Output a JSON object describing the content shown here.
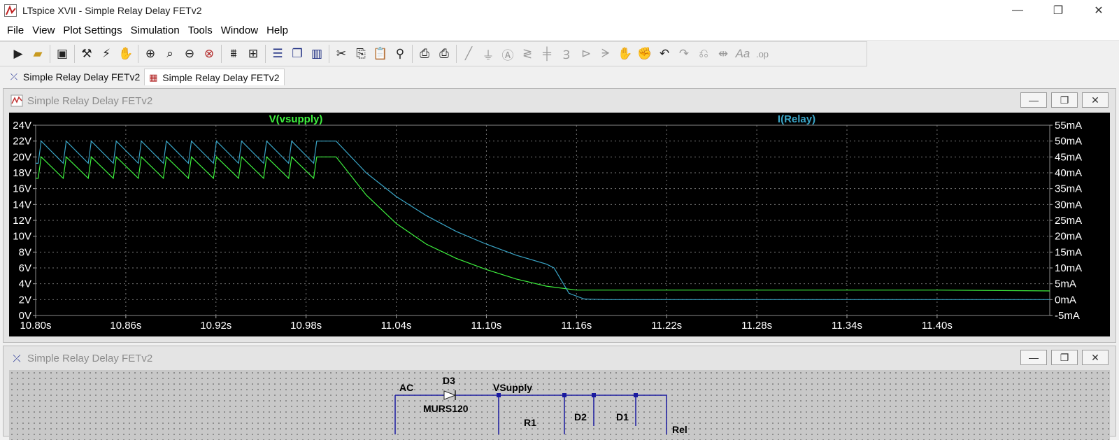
{
  "window": {
    "title": "LTspice XVII - Simple Relay Delay FETv2",
    "controls": [
      "—",
      "❐",
      "✕"
    ]
  },
  "menu": [
    {
      "label": "File"
    },
    {
      "label": "View"
    },
    {
      "label": "Plot Settings"
    },
    {
      "label": "Simulation"
    },
    {
      "label": "Tools"
    },
    {
      "label": "Window"
    },
    {
      "label": "Help"
    }
  ],
  "toolbar": {
    "icons": [
      "run-icon",
      "open-icon",
      "save-icon",
      "control-panel-icon",
      "run-man-icon",
      "pan-hand-icon",
      "zoom-in-icon",
      "zoom-area-icon",
      "zoom-out-icon",
      "zoom-cancel-icon",
      "autorange-icon",
      "add-plot-icon",
      "tile-horizontal-icon",
      "cascade-icon",
      "tile-vertical-icon",
      "cut-icon",
      "copy-icon",
      "paste-icon",
      "find-icon",
      "print-icon",
      "print-setup-icon",
      "wire-icon",
      "ground-icon",
      "label-icon",
      "resistor-icon",
      "capacitor-icon",
      "inductor-icon",
      "diode-icon",
      "component-icon",
      "move-icon",
      "drag-icon",
      "undo-icon",
      "redo-icon",
      "rotate-icon",
      "mirror-icon",
      "text-icon",
      "spice-directive-icon"
    ]
  },
  "tabs": [
    {
      "label": "Simple Relay Delay FETv2",
      "kind": "schematic"
    },
    {
      "label": "Simple Relay Delay FETv2",
      "kind": "waveform"
    }
  ],
  "plot_window": {
    "title": "Simple Relay Delay FETv2"
  },
  "schematic_window": {
    "title": "Simple Relay Delay FETv2",
    "labels": {
      "ac": "AC",
      "d3": "D3",
      "vsupply": "VSupply",
      "murs": "MURS120",
      "r1": "R1",
      "d2": "D2",
      "d1": "D1",
      "relay": "Rel"
    }
  },
  "chart_data": {
    "type": "line",
    "x_unit": "s",
    "xlim": [
      10.8,
      11.475
    ],
    "xticks": [
      "10.80s",
      "10.86s",
      "10.92s",
      "10.98s",
      "11.04s",
      "11.10s",
      "11.16s",
      "11.22s",
      "11.28s",
      "11.34s",
      "11.40s"
    ],
    "left_axis": {
      "unit": "V",
      "ylim": [
        0,
        24
      ],
      "ticks": [
        "24V",
        "22V",
        "20V",
        "18V",
        "16V",
        "14V",
        "12V",
        "10V",
        "8V",
        "6V",
        "4V",
        "2V",
        "0V"
      ]
    },
    "right_axis": {
      "unit": "mA",
      "ylim": [
        -5,
        55
      ],
      "ticks": [
        "55mA",
        "50mA",
        "45mA",
        "40mA",
        "35mA",
        "30mA",
        "25mA",
        "20mA",
        "15mA",
        "10mA",
        "5mA",
        "0mA",
        "-5mA"
      ]
    },
    "grid": true,
    "series": [
      {
        "name": "V(vsupply)",
        "axis": "left",
        "color": "#3ef03e",
        "ripple": {
          "period": 0.01667,
          "peak": 20.0,
          "trough": 17.3,
          "end": 11.0
        },
        "decay": [
          [
            11.0,
            20.0
          ],
          [
            11.02,
            15.2
          ],
          [
            11.04,
            11.6
          ],
          [
            11.06,
            9.0
          ],
          [
            11.08,
            7.2
          ],
          [
            11.1,
            5.8
          ],
          [
            11.12,
            4.6
          ],
          [
            11.14,
            3.7
          ],
          [
            11.16,
            3.2
          ],
          [
            11.22,
            3.2
          ],
          [
            11.4,
            3.2
          ],
          [
            11.475,
            3.1
          ]
        ]
      },
      {
        "name": "I(Relay)",
        "axis": "right",
        "color": "#3aa6c8",
        "ripple": {
          "period": 0.01667,
          "peak": 50.0,
          "trough": 43.0,
          "end": 11.0
        },
        "decay": [
          [
            11.0,
            50.0
          ],
          [
            11.02,
            40.0
          ],
          [
            11.04,
            32.5
          ],
          [
            11.06,
            26.5
          ],
          [
            11.08,
            21.5
          ],
          [
            11.1,
            17.5
          ],
          [
            11.12,
            14.0
          ],
          [
            11.14,
            11.2
          ],
          [
            11.145,
            10.0
          ],
          [
            11.155,
            2.0
          ],
          [
            11.165,
            0.2
          ],
          [
            11.18,
            0.0
          ],
          [
            11.475,
            0.0
          ]
        ]
      }
    ]
  }
}
